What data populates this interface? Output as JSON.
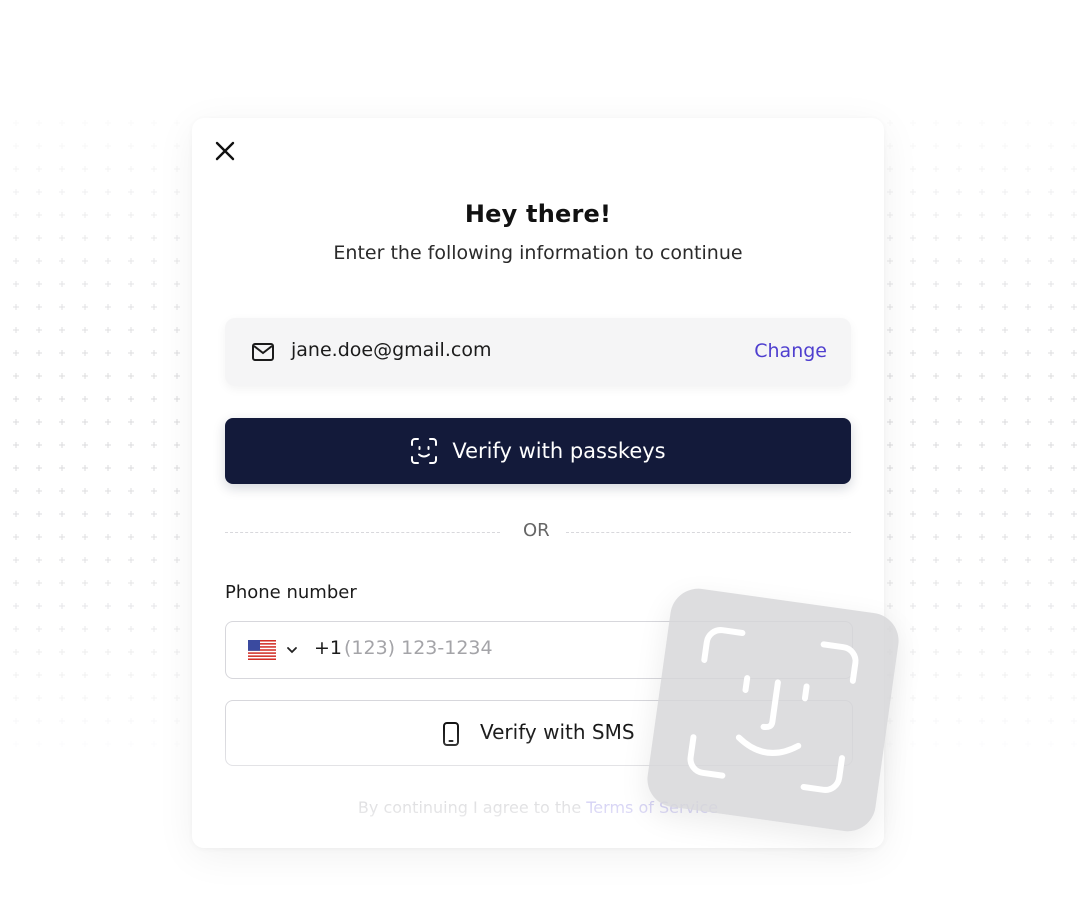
{
  "dialog": {
    "title": "Hey there!",
    "subtitle": "Enter the following information to continue"
  },
  "email": {
    "value": "jane.doe@gmail.com",
    "change_label": "Change"
  },
  "passkey_button": {
    "label": "Verify with passkeys"
  },
  "divider": {
    "text": "OR"
  },
  "phone": {
    "label": "Phone number",
    "country_flag": "us-flag",
    "dial_code": "+1",
    "placeholder": "(123) 123-1234"
  },
  "sms_button": {
    "label": "Verify with SMS"
  },
  "terms": {
    "prefix": "By continuing I agree to the ",
    "link": "Terms of Service"
  },
  "colors": {
    "primary_button": "#131a3a",
    "link": "#4f3fcf"
  }
}
